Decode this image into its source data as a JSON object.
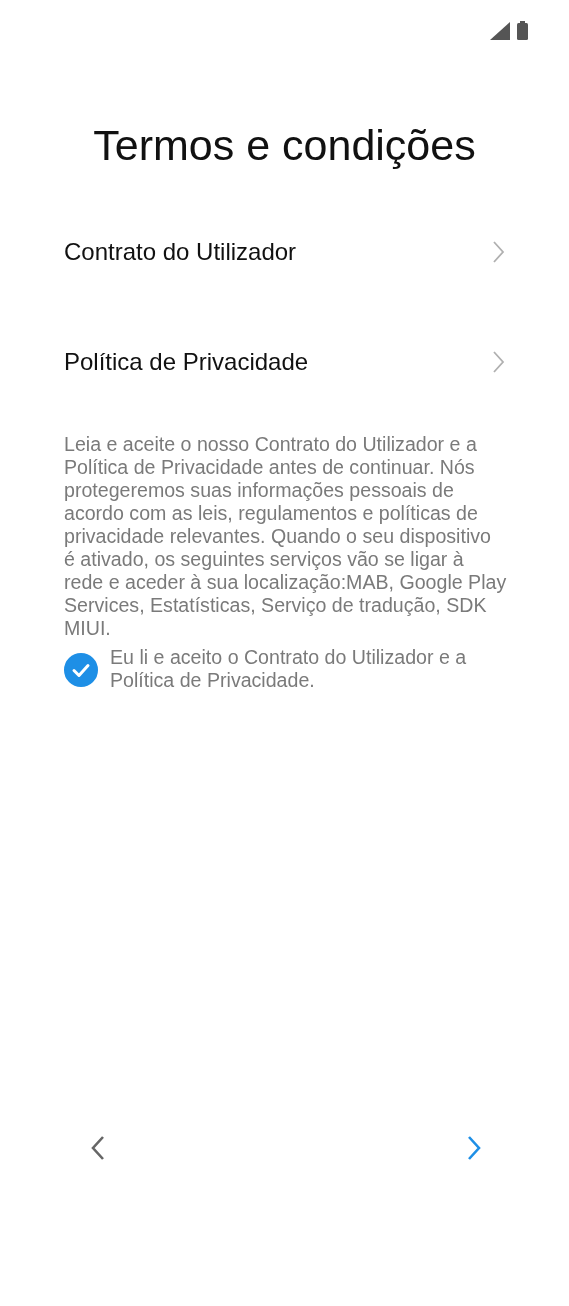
{
  "title": "Termos e condições",
  "links": [
    {
      "label": "Contrato do Utilizador"
    },
    {
      "label": "Política de Privacidade"
    }
  ],
  "notice": "Leia e aceite o nosso Contrato do Utilizador e a Política de Privacidade antes de continuar. Nós protegeremos suas informações pessoais de acordo com as leis, regulamentos e políticas de privacidade relevantes. Quando o seu dispositivo é ativado, os seguintes serviços vão se ligar à rede e aceder à sua localização:MAB, Google Play Services, Estatísticas, Serviço de tradução, SDK MIUI.",
  "agreement": {
    "label": "Eu li e aceito o Contrato do Utilizador e a Política de Privacidade.",
    "checked": true
  }
}
